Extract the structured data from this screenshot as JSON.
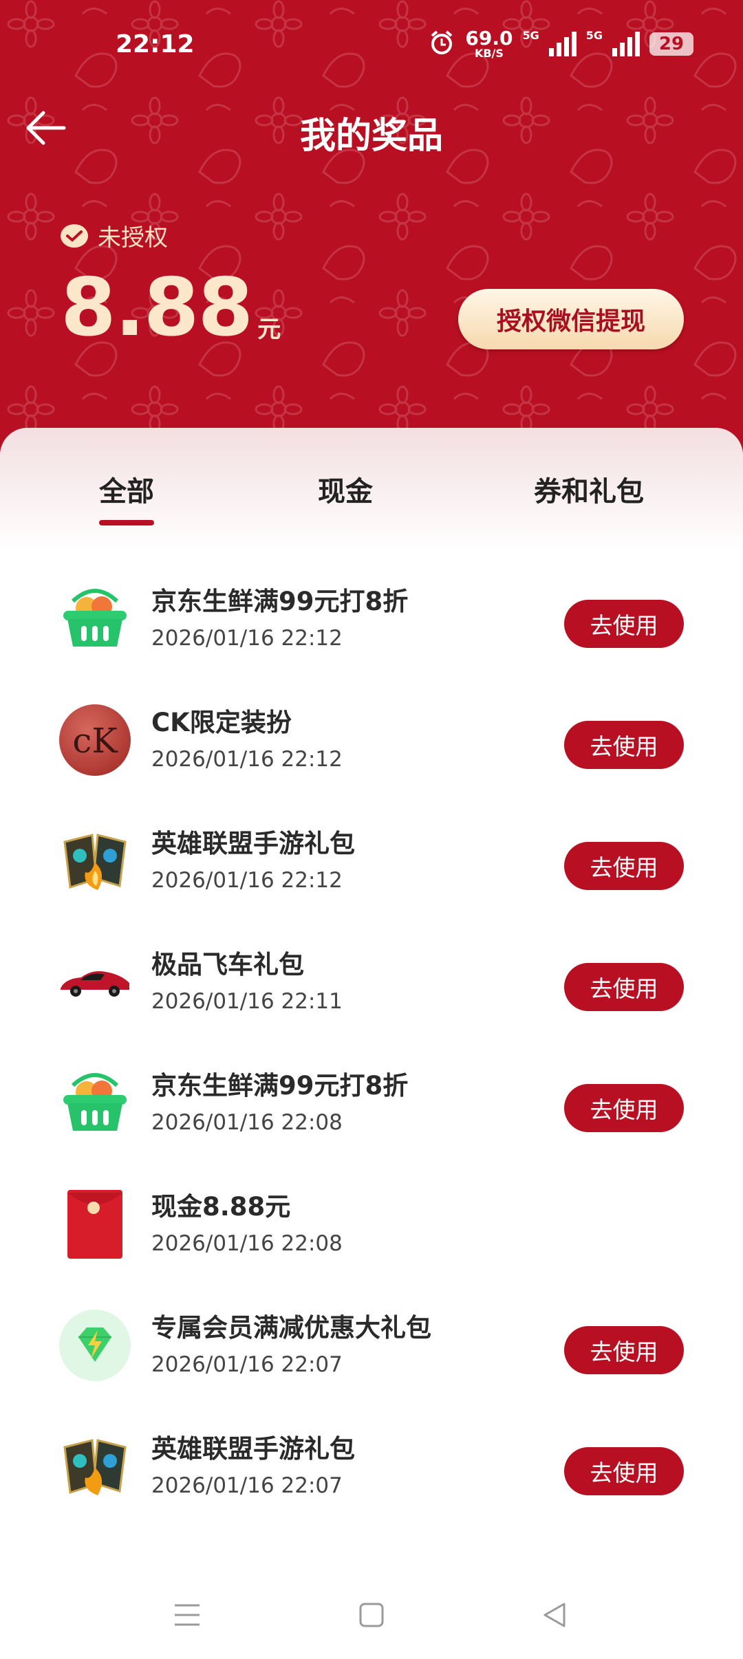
{
  "status_bar": {
    "time": "22:12",
    "net_speed": "69.0",
    "net_unit": "KB/S",
    "sim1": "5G",
    "sim2": "5G",
    "battery": "29",
    "alarm_icon": "alarm-icon"
  },
  "header": {
    "title": "我的奖品",
    "back_icon": "arrow-left-icon",
    "auth_status": "未授权",
    "amount": "8.88",
    "amount_unit": "元",
    "withdraw_label": "授权微信提现",
    "accent_color": "#b90f22"
  },
  "tabs": [
    {
      "label": "全部",
      "active": true
    },
    {
      "label": "现金",
      "active": false
    },
    {
      "label": "券和礼包",
      "active": false
    }
  ],
  "prizes": [
    {
      "name": "京东生鲜满99元打8折",
      "date": "2026/01/16 22:12",
      "action": "去使用",
      "icon": "basket-icon"
    },
    {
      "name": "CK限定装扮",
      "date": "2026/01/16 22:12",
      "action": "去使用",
      "icon": "ck-logo-icon"
    },
    {
      "name": "英雄联盟手游礼包",
      "date": "2026/01/16 22:12",
      "action": "去使用",
      "icon": "game-cards-icon"
    },
    {
      "name": "极品飞车礼包",
      "date": "2026/01/16 22:11",
      "action": "去使用",
      "icon": "race-car-icon"
    },
    {
      "name": "京东生鲜满99元打8折",
      "date": "2026/01/16 22:08",
      "action": "去使用",
      "icon": "basket-icon"
    },
    {
      "name": "现金8.88元",
      "date": "2026/01/16 22:08",
      "action": "",
      "icon": "red-envelope-icon"
    },
    {
      "name": "专属会员满减优惠大礼包",
      "date": "2026/01/16 22:07",
      "action": "去使用",
      "icon": "diamond-icon"
    },
    {
      "name": "英雄联盟手游礼包",
      "date": "2026/01/16 22:07",
      "action": "去使用",
      "icon": "game-cards-icon"
    }
  ],
  "nav": {
    "menu_icon": "menu-icon",
    "home_icon": "home-icon",
    "back_icon": "back-triangle-icon"
  }
}
